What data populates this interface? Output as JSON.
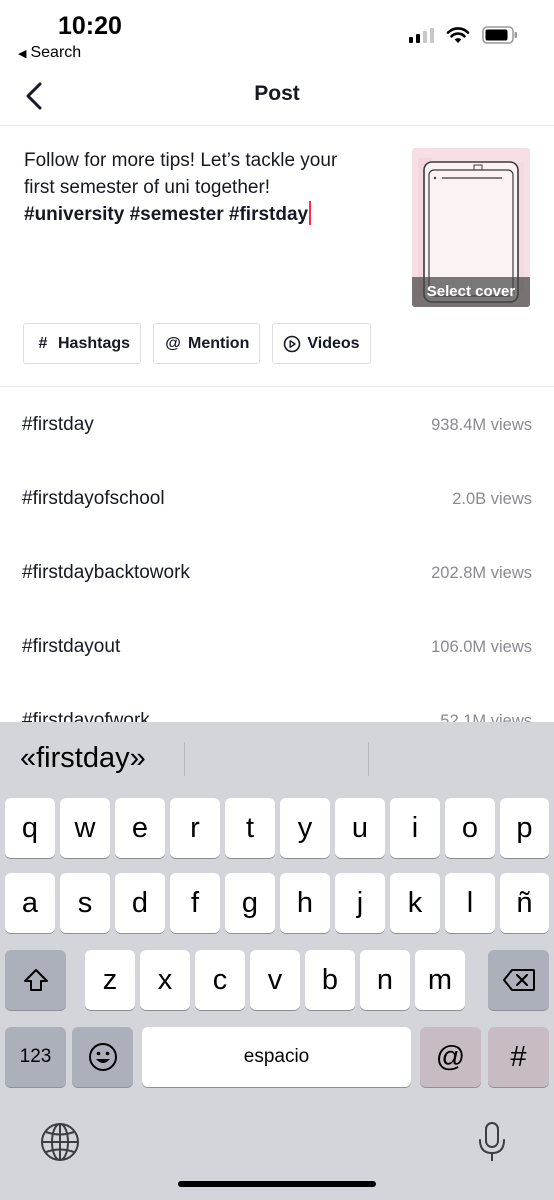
{
  "status_bar": {
    "time": "10:20",
    "back_label": "Search",
    "back_icon": "triangle-left",
    "signal_icon": "cellular-signal",
    "wifi_icon": "wifi",
    "battery_icon": "battery"
  },
  "header": {
    "title": "Post",
    "back_icon": "chevron-left"
  },
  "caption": {
    "line1": "Follow for more tips! Let’s tackle your",
    "line2": "first semester of uni together!",
    "hashtags": "#university #semester #firstday"
  },
  "cover": {
    "label": "Select cover"
  },
  "chips": [
    {
      "icon": "#",
      "label": "Hashtags"
    },
    {
      "icon": "@",
      "label": "Mention"
    },
    {
      "icon": "play-circle",
      "label": "Videos"
    }
  ],
  "suggestions": [
    {
      "tag": "#firstday",
      "views": "938.4M views"
    },
    {
      "tag": "#firstdayofschool",
      "views": "2.0B views"
    },
    {
      "tag": "#firstdaybacktowork",
      "views": "202.8M views"
    },
    {
      "tag": "#firstdayout",
      "views": "106.0M views"
    },
    {
      "tag": "#firstdayofwork",
      "views": "52.1M views"
    }
  ],
  "keyboard": {
    "prediction": "«firstday»",
    "row1": [
      "q",
      "w",
      "e",
      "r",
      "t",
      "y",
      "u",
      "i",
      "o",
      "p"
    ],
    "row2": [
      "a",
      "s",
      "d",
      "f",
      "g",
      "h",
      "j",
      "k",
      "l",
      "ñ"
    ],
    "row3": [
      "z",
      "x",
      "c",
      "v",
      "b",
      "n",
      "m"
    ],
    "numbers_key": "123",
    "space_key": "espacio",
    "at_key": "@",
    "hash_key": "#",
    "shift_icon": "shift-arrow",
    "delete_icon": "backspace",
    "emoji_icon": "emoji-smiley",
    "globe_icon": "globe",
    "mic_icon": "microphone"
  },
  "colors": {
    "caret": "#fe2c55",
    "keyboard_bg": "#d3d5db",
    "muted_text": "#8a8b91"
  }
}
